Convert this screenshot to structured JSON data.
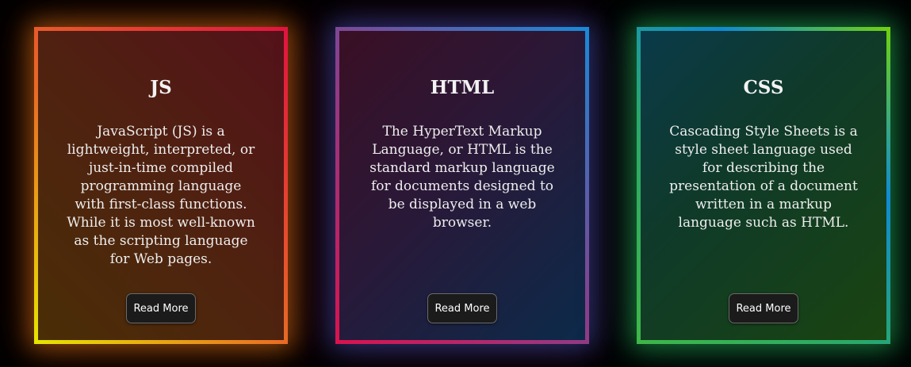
{
  "cards": [
    {
      "title": "JS",
      "text": "JavaScript (JS) is a lightweight, interpreted, or just-in-time compiled programming language with first-class functions. While it is most well-known as the scripting language for Web pages.",
      "button_label": "Read More",
      "accent_colors": [
        "#e7e400",
        "#e86a26",
        "#e3143f"
      ]
    },
    {
      "title": "HTML",
      "text": "The HyperText Markup Language, or HTML is the standard markup language for documents designed to be displayed in a web browser.",
      "button_label": "Read More",
      "accent_colors": [
        "#d8134e",
        "#8a3f8c",
        "#1a8ad8"
      ]
    },
    {
      "title": "CSS",
      "text": "Cascading Style Sheets is a style sheet language used for describing the presentation of a document written in a markup language such as HTML.",
      "button_label": "Read More",
      "accent_colors": [
        "#0f8ad4",
        "#2aa86a",
        "#6ed012"
      ]
    }
  ]
}
